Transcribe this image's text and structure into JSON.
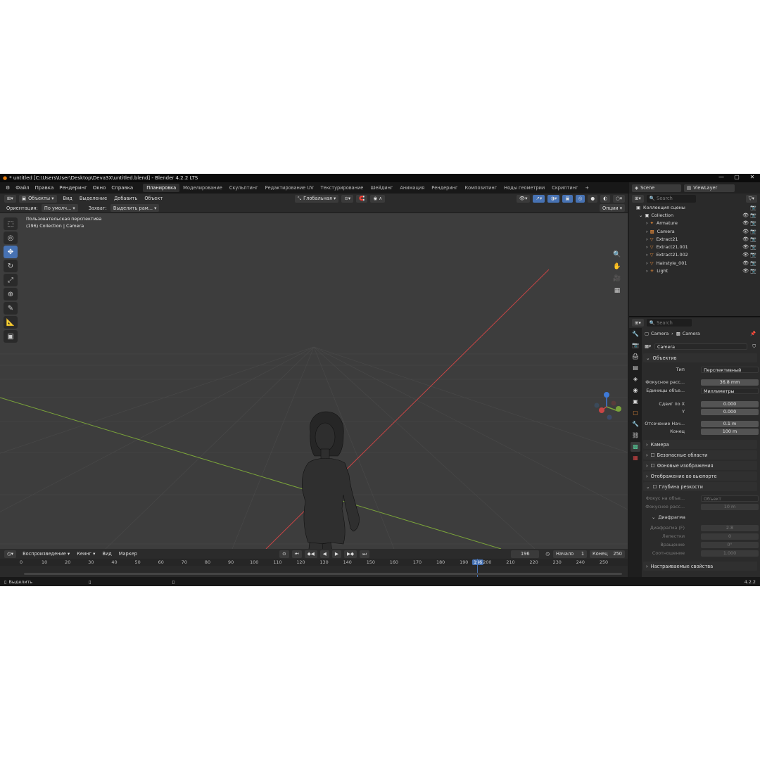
{
  "window": {
    "title": "* untitled [C:\\Users\\User\\Desktop\\Deva3X\\untitled.blend] - Blender 4.2.2 LTS"
  },
  "menu": [
    "Файл",
    "Правка",
    "Рендеринг",
    "Окно",
    "Справка"
  ],
  "workspaces": [
    "Планировка",
    "Моделирование",
    "Скульптинг",
    "Редактирование UV",
    "Текстурирование",
    "Шейдинг",
    "Анимация",
    "Рендеринг",
    "Композитинг",
    "Ноды геометрии",
    "Скриптинг",
    "+"
  ],
  "viewport_header": {
    "mode": "Объекты",
    "items": [
      "Вид",
      "Выделение",
      "Добавить",
      "Объект"
    ],
    "transform": "Глобальная"
  },
  "tool_options": {
    "orientation_label": "Ориентация:",
    "orientation_value": "По умолч...",
    "snap_label": "Захват:",
    "snap_value": "Выделить рам...",
    "options": "Опции"
  },
  "viewport": {
    "perspective": "Пользовательская перспектива",
    "info": "(196) Collection | Camera"
  },
  "timeline": {
    "playback": "Воспроизведение",
    "keying": "Кеинг",
    "view": "Вид",
    "marker": "Маркер",
    "current_frame": "196",
    "start_label": "Начало",
    "start": "1",
    "end_label": "Конец",
    "end": "250",
    "ticks": [
      "0",
      "10",
      "20",
      "30",
      "40",
      "50",
      "60",
      "70",
      "80",
      "90",
      "100",
      "110",
      "120",
      "130",
      "140",
      "150",
      "160",
      "170",
      "180",
      "190",
      "196",
      "200",
      "210",
      "220",
      "230",
      "240",
      "250"
    ]
  },
  "status": {
    "select": "Выделить",
    "version": "4.2.2"
  },
  "outliner": {
    "scene": "Scene",
    "view_layer": "ViewLayer",
    "search": "Search",
    "scene_collection": "Коллекция сцены",
    "collection": "Collection",
    "items": [
      "Armature",
      "Camera",
      "Extract21",
      "Extract21.001",
      "Extract21.002",
      "Hairstyle_001",
      "Light"
    ]
  },
  "properties": {
    "search": "Search",
    "breadcrumb": [
      "Camera",
      "Camera"
    ],
    "datablock": "Camera",
    "lens_panel": "Объектив",
    "type_label": "Тип",
    "type_value": "Перспективный",
    "focal_label": "Фокусное расс...",
    "focal_value": "36.8 mm",
    "units_label": "Единицы объе...",
    "units_value": "Миллиметры",
    "shift_x_label": "Сдвиг по X",
    "shift_x": "0.000",
    "shift_y_label": "Y",
    "shift_y": "0.000",
    "clip_start_label": "Отсечение Нач...",
    "clip_start": "0.1 m",
    "clip_end_label": "Конец",
    "clip_end": "100 m",
    "panels": [
      "Камера",
      "Безопасные области",
      "Фоновые изображения",
      "Отображение во вьюпорте",
      "Глубина резкости"
    ],
    "dof_focus_obj_label": "Фокус на объе...",
    "dof_focus_obj_placeholder": "Объект",
    "dof_focus_dist_label": "Фокусное расс...",
    "dof_focus_dist": "10 m",
    "aperture": "Диафрагма",
    "fstop_label": "Диафрагма (F)",
    "fstop": "2.8",
    "blades_label": "Лепестки",
    "blades": "0",
    "rotation_label": "Вращение",
    "rotation": "0°",
    "ratio_label": "Соотношение",
    "ratio": "1.000",
    "custom_props": "Настраиваемые свойства"
  },
  "colors": {
    "accent": "#4772b3",
    "x_axis": "#c84545",
    "y_axis": "#7aa33a",
    "z_axis": "#3e7ad8"
  }
}
